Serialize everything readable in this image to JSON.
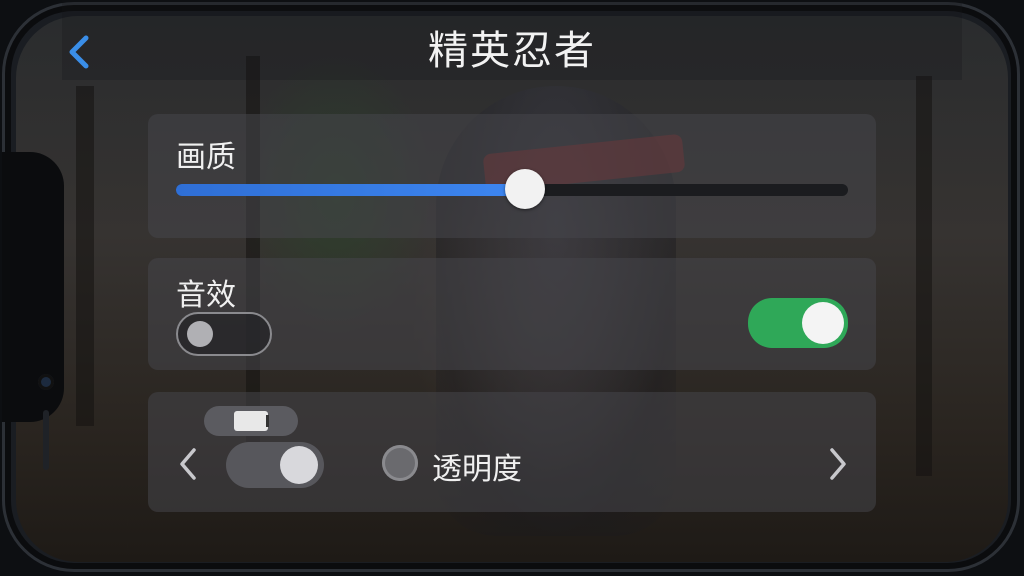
{
  "header": {
    "title": "精英忍者",
    "back_icon": "chevron-left-icon"
  },
  "settings": {
    "quality": {
      "label": "画质",
      "value_fraction": 0.52
    },
    "sound": {
      "label": "音效",
      "left_toggle_on": false,
      "right_toggle_on": true
    },
    "opacity": {
      "label": "透明度",
      "prev_icon": "chevron-left-icon",
      "next_icon": "chevron-right-icon",
      "toggle_on": true
    }
  },
  "colors": {
    "accent_blue": "#3d86f0",
    "toggle_green": "#2fa858"
  }
}
